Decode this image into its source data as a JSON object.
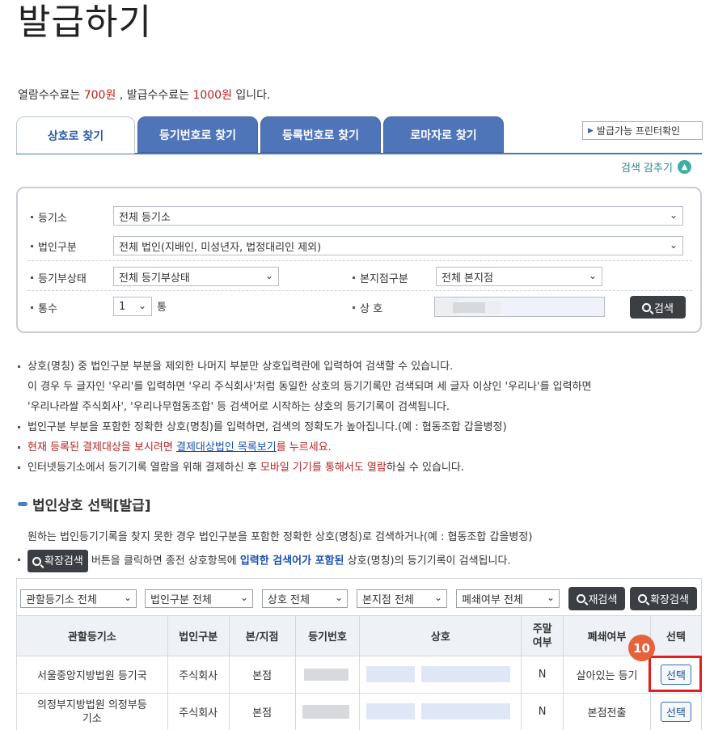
{
  "page_title": "발급하기",
  "fee": {
    "prefix": "열람수수료는 ",
    "view_fee": "700원",
    "mid": " , 발급수수료는 ",
    "issue_fee": "1000원",
    "suffix": " 입니다."
  },
  "tabs": [
    {
      "label": "상호로 찾기",
      "active": true
    },
    {
      "label": "등기번호로 찾기",
      "active": false
    },
    {
      "label": "등록번호로 찾기",
      "active": false
    },
    {
      "label": "로마자로 찾기",
      "active": false
    }
  ],
  "printer_check_label": "발급가능 프린터확인",
  "collapse_search_label": "검색 감추기",
  "form": {
    "registry_label": "등기소",
    "registry_value": "전체 등기소",
    "corp_type_label": "법인구분",
    "corp_type_value": "전체 법인(지배인, 미성년자, 법정대리인 제외)",
    "reg_status_label": "등기부상태",
    "reg_status_value": "전체 등기부상태",
    "branch_type_label": "본지점구분",
    "branch_type_value": "전체 본지점",
    "copies_label": "통수",
    "copies_value": "1",
    "copies_unit": "통",
    "name_label": "상 호",
    "search_button": "검색"
  },
  "notes": {
    "n1_l1": "상호(명칭) 중 법인구분 부분을 제외한 나머지 부분만 상호입력란에 입력하여 검색할 수 있습니다.",
    "n1_l2": "이 경우 두 글자인 '우리'를 입력하면 '우리 주식회사'처럼 동일한 상호의 등기기록만 검색되며 세 글자 이상인 '우리나'를 입력하면",
    "n1_l3": "'우리나라쌀 주식회사', '우리나무협동조합' 등 검색어로 시작하는 상호의 등기기록이 검색됩니다.",
    "n2": "법인구분 부분을 포함한 정확한 상호(명칭)를 입력하면, 검색의 정확도가 높아집니다.(예 : 협동조합 갑을병정)",
    "n3_a": "현재 등록된 결제대상을 보시려면 ",
    "n3_link": "결제대상법인 목록보기",
    "n3_b": "를 누르세요.",
    "n4_a": "인터넷등기소에서 등기기록 열람을 위해 결제하신 후 ",
    "n4_red": "모바일 기기를 통해서도 열람",
    "n4_b": "하실 수 있습니다."
  },
  "section_title": "법인상호 선택[발급]",
  "notes2": {
    "m1": "원하는 법인등기기록을 찾지 못한 경우 법인구분을 포함한 정확한 상호(명칭)로 검색하거나(예 : 협동조합 갑을병정)",
    "m2_btn": "확장검색",
    "m2_a": "버튼을 클릭하면 종전 상호항목에 ",
    "m2_blue": "입력한 검색어가 포함된",
    "m2_b": " 상호(명칭)의 등기기록이 검색됩니다."
  },
  "filters": [
    "관할등기소 전체",
    "법인구분 전체",
    "상호 전체",
    "본지점 전체",
    "폐쇄여부 전체"
  ],
  "research_button": "재검색",
  "extend_button": "확장검색",
  "table": {
    "headers": [
      "관할등기소",
      "법인구분",
      "본/지점",
      "등기번호",
      "상호",
      "주말\n여부",
      "폐쇄여부",
      "선택"
    ],
    "header_weekend_l1": "주말",
    "header_weekend_l2": "여부",
    "rows": [
      {
        "office": "서울중앙지방법원 등기국",
        "corp_type": "주식회사",
        "branch": "본점",
        "weekend": "N",
        "closed": "살아있는 등기",
        "select": "선택"
      },
      {
        "office_l1": "의정부지방법원 의정부등",
        "office_l2": "기소",
        "corp_type": "주식회사",
        "branch": "본점",
        "weekend": "N",
        "closed": "본점전출",
        "select": "선택"
      }
    ]
  },
  "annotation_badge": "10",
  "colors": {
    "accent_blue": "#4f75b9",
    "fee_red": "#bb2222",
    "badge": "#e5623a",
    "highlight": "#e21e1e"
  }
}
